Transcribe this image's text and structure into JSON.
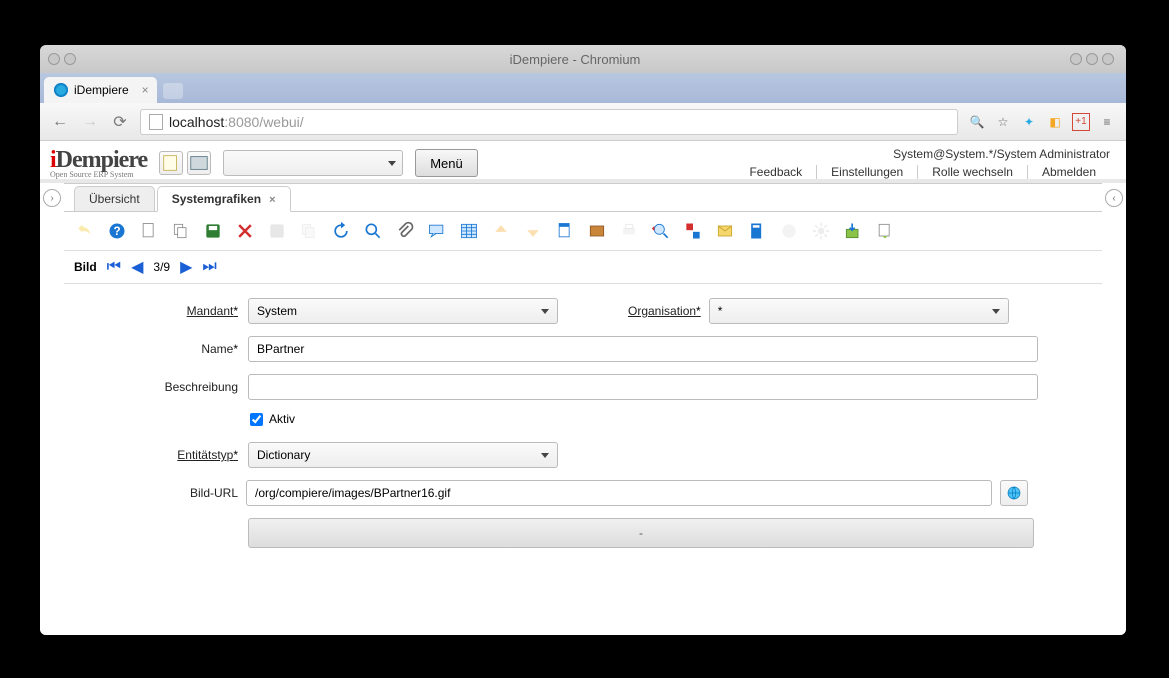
{
  "window": {
    "title": "iDempiere - Chromium"
  },
  "browser": {
    "tab_title": "iDempiere",
    "url_gray": ":8080/webui/",
    "url_host": "localhost"
  },
  "header": {
    "logo": "iDempiere",
    "logo_sub": "Open Source ERP System",
    "menu_btn": "Menü",
    "context": "System@System.*/System Administrator",
    "links": {
      "feedback": "Feedback",
      "settings": "Einstellungen",
      "switch_role": "Rolle wechseln",
      "logout": "Abmelden"
    }
  },
  "tabs": {
    "overview": "Übersicht",
    "sysgraphics": "Systemgrafiken"
  },
  "recordnav": {
    "label": "Bild",
    "position": "3/9"
  },
  "form": {
    "mandant_label": "Mandant",
    "mandant_value": "System",
    "org_label": "Organisation",
    "org_value": "*",
    "name_label": "Name",
    "name_value": "BPartner",
    "desc_label": "Beschreibung",
    "desc_value": "",
    "active_label": "Aktiv",
    "active_checked": true,
    "entity_label": "Entitätstyp",
    "entity_value": "Dictionary",
    "url_label": "Bild-URL",
    "url_value": "/org/compiere/images/BPartner16.gif",
    "bigbtn_label": "-"
  }
}
